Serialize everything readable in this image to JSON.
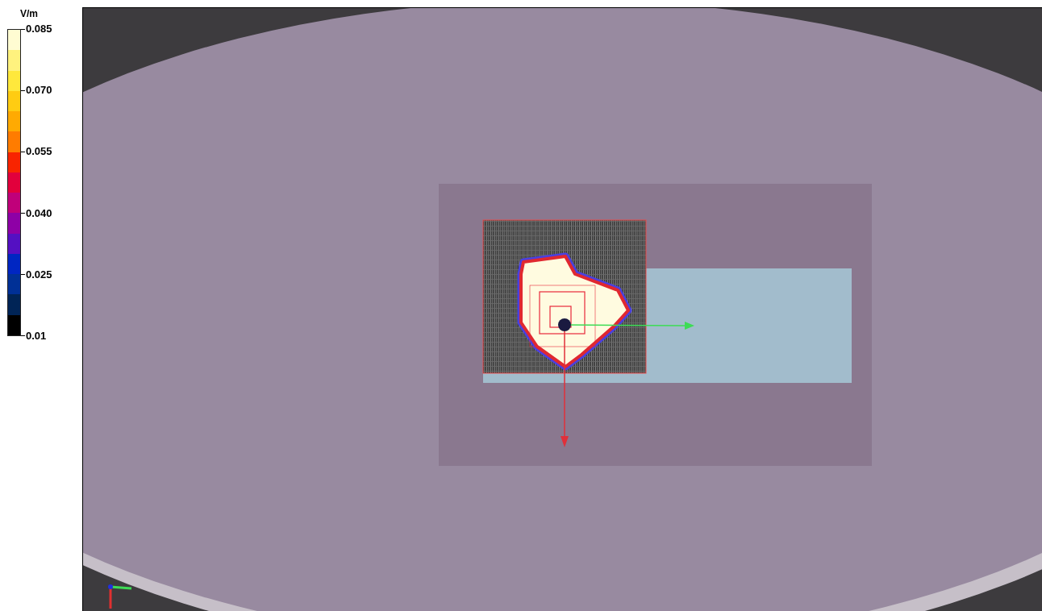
{
  "legend": {
    "unit": "V/m",
    "bands": [
      {
        "color": "#fffcd2"
      },
      {
        "color": "#fff27e"
      },
      {
        "color": "#ffe83c"
      },
      {
        "color": "#ffcc12"
      },
      {
        "color": "#ffaa02"
      },
      {
        "color": "#ff7c00"
      },
      {
        "color": "#f82400"
      },
      {
        "color": "#e2003c"
      },
      {
        "color": "#c0007a"
      },
      {
        "color": "#8e00a6"
      },
      {
        "color": "#5410c2"
      },
      {
        "color": "#0026c2"
      },
      {
        "color": "#003096"
      },
      {
        "color": "#002456"
      },
      {
        "color": "#000000"
      }
    ],
    "ticks": [
      "0.085",
      "0.070",
      "0.055",
      "0.040",
      "0.025",
      "0.01"
    ]
  }
}
